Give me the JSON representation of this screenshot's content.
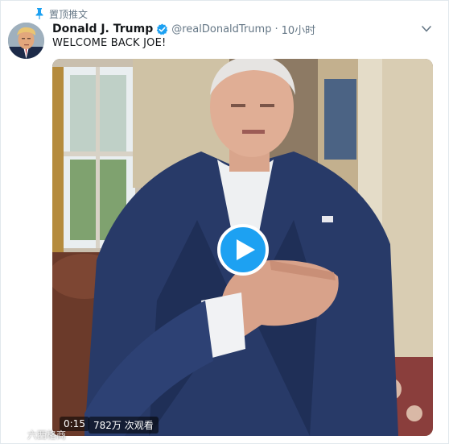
{
  "pinned": {
    "label": "置顶推文",
    "icon": "pin-icon"
  },
  "author": {
    "display_name": "Donald J. Trump",
    "handle": "@realDonaldTrump",
    "separator": "·",
    "time": "10小时",
    "verified": true
  },
  "tweet": {
    "text": "WELCOME BACK JOE!"
  },
  "media": {
    "type": "video",
    "duration": "0:15",
    "views": "782万 次观看"
  },
  "watermark": {
    "text": "六西格商"
  },
  "colors": {
    "accent": "#1da1f2",
    "name": "#14171a",
    "secondary": "#657786"
  }
}
